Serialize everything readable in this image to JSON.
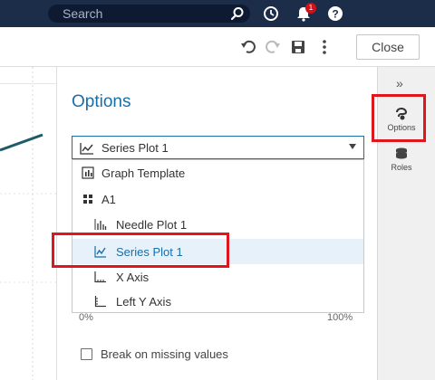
{
  "header": {
    "search_placeholder": "Search",
    "notification_count": "1",
    "icons": [
      "search-icon",
      "recent-icon",
      "notifications-icon",
      "help-icon"
    ]
  },
  "toolbar": {
    "close_label": "Close",
    "icons": [
      "undo-icon",
      "redo-icon",
      "save-icon",
      "more-icon"
    ]
  },
  "options": {
    "title": "Options",
    "selected_value": "Series Plot 1",
    "menu_items": [
      {
        "label": "Graph Template",
        "icon": "graph-template-icon"
      },
      {
        "label": "A1",
        "icon": "grid-icon"
      },
      {
        "label": "Needle Plot 1",
        "icon": "needle-plot-icon"
      },
      {
        "label": "Series Plot 1",
        "icon": "series-plot-icon",
        "selected": true
      },
      {
        "label": "X Axis",
        "icon": "x-axis-icon"
      },
      {
        "label": "Left Y Axis",
        "icon": "y-axis-icon"
      }
    ],
    "range_left": "0%",
    "range_right": "100%",
    "checkbox_label": "Break on missing values"
  },
  "rail": {
    "collapse_label": "»",
    "options_label": "Options",
    "roles_label": "Roles"
  },
  "colors": {
    "header": "#1c2d4a",
    "accent": "#1a6ea8",
    "highlight": "#e0161e",
    "graph_line": "#1f5b66"
  }
}
